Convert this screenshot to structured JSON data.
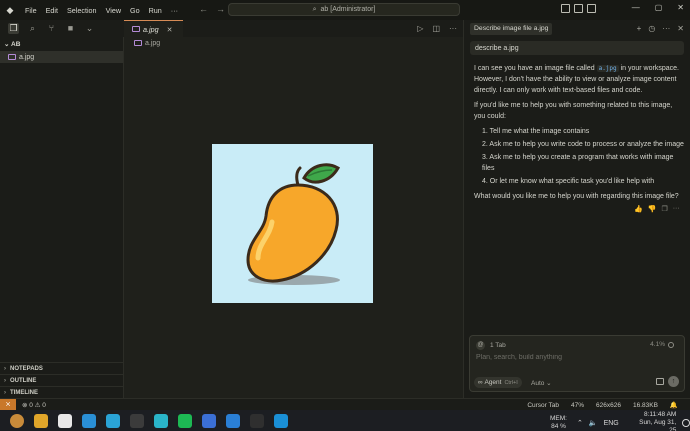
{
  "titlebar": {
    "menu": [
      "File",
      "Edit",
      "Selection",
      "View",
      "Go",
      "Run"
    ],
    "more": "···",
    "command_center": "ab [Administrator]"
  },
  "sidebar": {
    "folder": "AB",
    "files": [
      "a.jpg"
    ],
    "panels": [
      "NOTEPADS",
      "OUTLINE",
      "TIMELINE"
    ]
  },
  "editor": {
    "tab_label": "a.jpg",
    "breadcrumb": "a.jpg"
  },
  "chat": {
    "tab_title": "Describe image file a.jpg",
    "user_message": "describe a.jpg",
    "reply_intro_before": "I can see you have an image file called ",
    "reply_intro_code": "a.jpg",
    "reply_intro_after": " in your workspace. However, I don't have the ability to view or analyze image content directly. I can only work with text-based files and code.",
    "reply_offer": "If you'd like me to help you with something related to this image, you could:",
    "reply_list": [
      "1. Tell me what the image contains",
      "2. Ask me to help you write code to process or analyze the image",
      "3. Ask me to help you create a program that works with image files",
      "4. Or let me know what specific task you'd like help with"
    ],
    "reply_question": "What would you like me to help you with regarding this image file?",
    "composer": {
      "context": "1 Tab",
      "percent": "4.1%",
      "placeholder": "Plan, search, build anything",
      "agent_label": "Agent",
      "agent_shortcut": "Ctrl+I",
      "model_label": "Auto"
    }
  },
  "statusbar": {
    "problems": "⊗ 0 ⚠ 0",
    "cursor_tab": "Cursor Tab",
    "zoom": "47%",
    "dimensions": "626x626",
    "filesize": "16.83KB"
  },
  "taskbar": {
    "mem_label": "MEM:",
    "mem_value": "84 %",
    "lang": "ENG",
    "time": "8:11:48 AM",
    "date": "Sun, Aug 31, 25",
    "icon_colors": [
      "#c98b3a",
      "#e0a52a",
      "#e8e8e8",
      "#2a8fd6",
      "#2aa3d6",
      "#3b3b3b",
      "#2ab4c9",
      "#1db954",
      "#3b6fd6",
      "#2a7fd6",
      "#2f2f2f",
      "#1a8fd6"
    ]
  }
}
